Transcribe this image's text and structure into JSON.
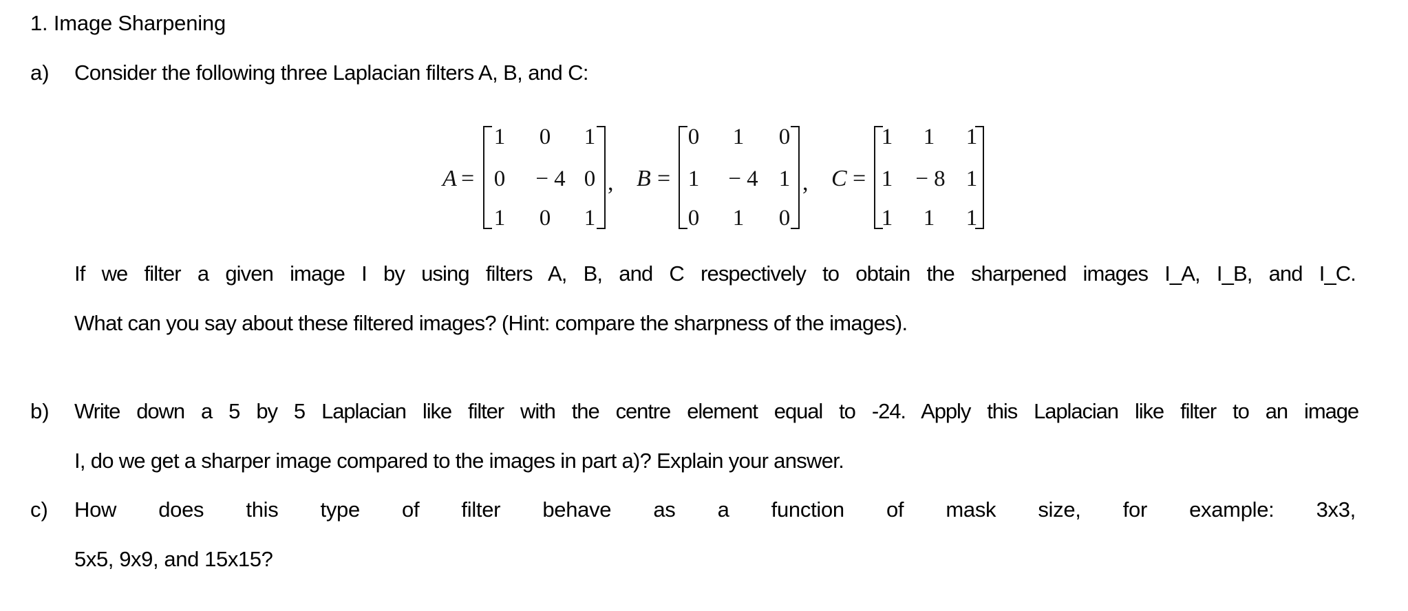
{
  "document": {
    "title": "1. Image Sharpening",
    "parts": [
      {
        "label": "a)",
        "lines": [
          "Consider the following three Laplacian filters A, B, and C:"
        ],
        "matrices": [
          {
            "name": "A",
            "equals": "=",
            "rows": [
              [
                "1",
                "0",
                "1"
              ],
              [
                "0",
                "− 4",
                "0"
              ],
              [
                "1",
                "0",
                "1"
              ]
            ],
            "trailing": ","
          },
          {
            "name": "B",
            "equals": "=",
            "rows": [
              [
                "0",
                "1",
                "0"
              ],
              [
                "1",
                "− 4",
                "1"
              ],
              [
                "0",
                "1",
                "0"
              ]
            ],
            "trailing": ","
          },
          {
            "name": "C",
            "equals": "=",
            "rows": [
              [
                "1",
                "1",
                "1"
              ],
              [
                "1",
                "− 8",
                "1"
              ],
              [
                "1",
                "1",
                "1"
              ]
            ],
            "trailing": ""
          }
        ],
        "after_lines": [
          "If we filter a given image I by using filters A, B, and C respectively to obtain the sharpened images I_A, I_B, and I_C.",
          "What can you say about these filtered images? (Hint: compare the sharpness of the images)."
        ]
      },
      {
        "label": "b)",
        "lines": [
          "Write down a 5 by 5 Laplacian like filter with the centre element equal to -24. Apply this Laplacian like filter to an image",
          "I, do we get a sharper image compared to the images in part a)? Explain your answer."
        ]
      },
      {
        "label": "c)",
        "lines": [
          "How does this type of filter behave as a function of mask size, for example: 3x3,",
          "5x5, 9x9, and 15x15?"
        ]
      }
    ]
  }
}
